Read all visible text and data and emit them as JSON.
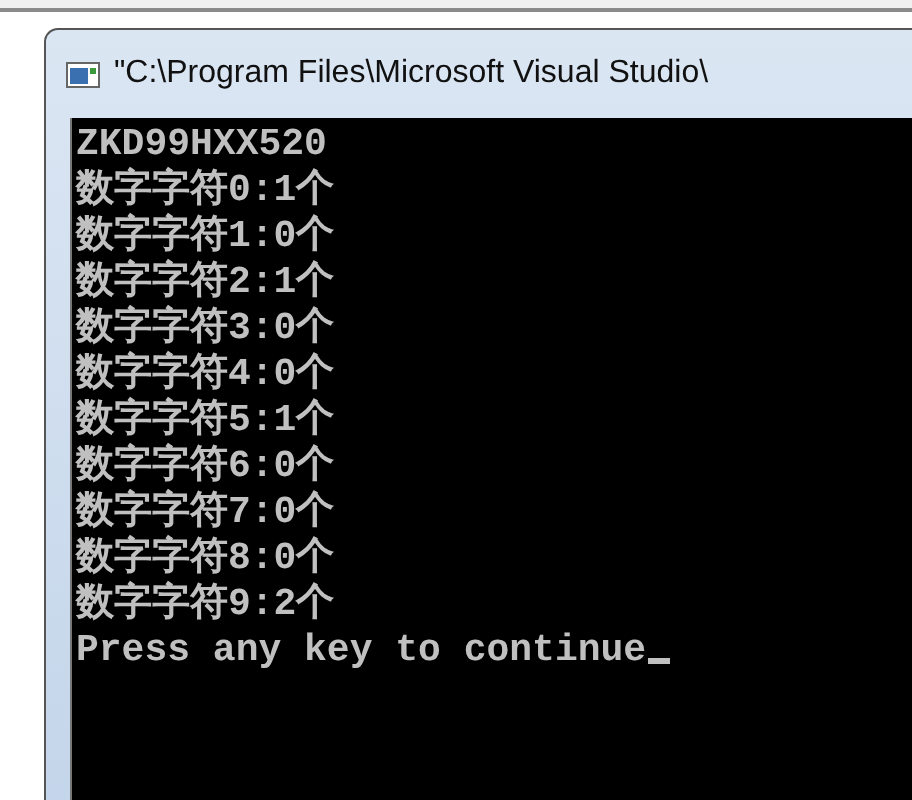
{
  "window": {
    "title": "\"C:\\Program Files\\Microsoft Visual Studio\\"
  },
  "console": {
    "lines": [
      "ZKD99HXX520",
      "数字字符0:1个",
      "数字字符1:0个",
      "数字字符2:1个",
      "数字字符3:0个",
      "数字字符4:0个",
      "数字字符5:1个",
      "数字字符6:0个",
      "数字字符7:0个",
      "数字字符8:0个",
      "数字字符9:2个",
      "Press any key to continue"
    ]
  }
}
